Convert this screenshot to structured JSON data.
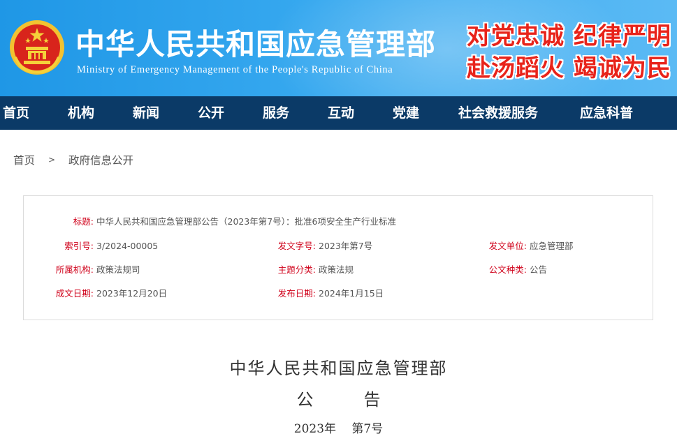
{
  "header": {
    "title": "中华人民共和国应急管理部",
    "subtitle": "Ministry of Emergency Management of the People's Republic of China",
    "slogan_line1": "对党忠诚 纪律严明",
    "slogan_line2": "赴汤蹈火 竭诚为民",
    "emblem_icon": "national-emblem-icon",
    "colors": {
      "banner": "#2ea2ec",
      "slogan": "#e8231a",
      "nav": "#0b3a67"
    }
  },
  "nav": {
    "items": [
      "首页",
      "机构",
      "新闻",
      "公开",
      "服务",
      "互动",
      "党建",
      "社会救援服务",
      "应急科普"
    ]
  },
  "breadcrumb": {
    "home": "首页",
    "separator": ">",
    "current": "政府信息公开"
  },
  "info": {
    "title_label": "标题:",
    "title_value": "中华人民共和国应急管理部公告（2023年第7号）：批准6项安全生产行业标准",
    "index_label": "索引号:",
    "index_value": "3/2024-00005",
    "doc_no_label": "发文字号:",
    "doc_no_value": "2023年第7号",
    "issuer_label": "发文单位:",
    "issuer_value": "应急管理部",
    "org_label": "所属机构:",
    "org_value": "政策法规司",
    "topic_label": "主题分类:",
    "topic_value": "政策法规",
    "type_label": "公文种类:",
    "type_value": "公告",
    "written_label": "成文日期:",
    "written_value": "2023年12月20日",
    "published_label": "发布日期:",
    "published_value": "2024年1月15日"
  },
  "document": {
    "org": "中华人民共和国应急管理部",
    "type": "公　　　告",
    "number": "2023年　 第7号"
  }
}
